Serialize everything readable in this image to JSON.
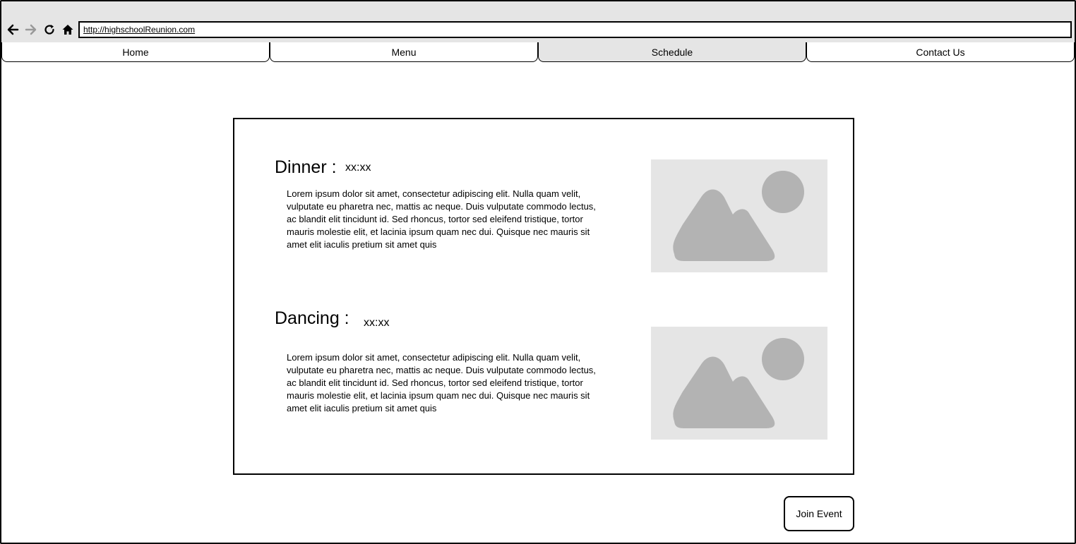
{
  "browser": {
    "url": "http://highschoolReunion.com",
    "icons": [
      "back-arrow-icon",
      "forward-arrow-icon",
      "reload-icon",
      "home-icon"
    ]
  },
  "nav": {
    "tabs": [
      {
        "label": "Home",
        "active": false
      },
      {
        "label": "Menu",
        "active": false
      },
      {
        "label": "Schedule",
        "active": true
      },
      {
        "label": "Contact Us",
        "active": false
      }
    ]
  },
  "schedule": {
    "items": [
      {
        "title": "Dinner :",
        "time": "xx:xx",
        "description": "Lorem ipsum dolor sit amet, consectetur adipiscing elit. Nulla quam velit, vulputate eu pharetra nec, mattis ac neque. Duis vulputate commodo lectus, ac blandit elit tincidunt id. Sed rhoncus, tortor sed eleifend tristique, tortor mauris molestie elit, et lacinia ipsum quam nec dui. Quisque nec mauris sit amet elit iaculis pretium sit amet quis",
        "image_icon": "image-placeholder-icon"
      },
      {
        "title": "Dancing :",
        "time": "xx:xx",
        "description": "Lorem ipsum dolor sit amet, consectetur adipiscing elit. Nulla quam velit, vulputate eu pharetra nec, mattis ac neque. Duis vulputate commodo lectus, ac blandit elit tincidunt id. Sed rhoncus, tortor sed eleifend tristique, tortor mauris molestie elit, et lacinia ipsum quam nec dui. Quisque nec mauris sit amet elit iaculis pretium sit amet quis",
        "image_icon": "image-placeholder-icon"
      }
    ]
  },
  "actions": {
    "join_label": "Join Event"
  },
  "colors": {
    "chrome_bg": "#e5e5e5",
    "placeholder_bg": "#e5e5e5",
    "placeholder_shape": "#b3b3b3",
    "disabled_icon": "#999999",
    "border": "#000000"
  }
}
